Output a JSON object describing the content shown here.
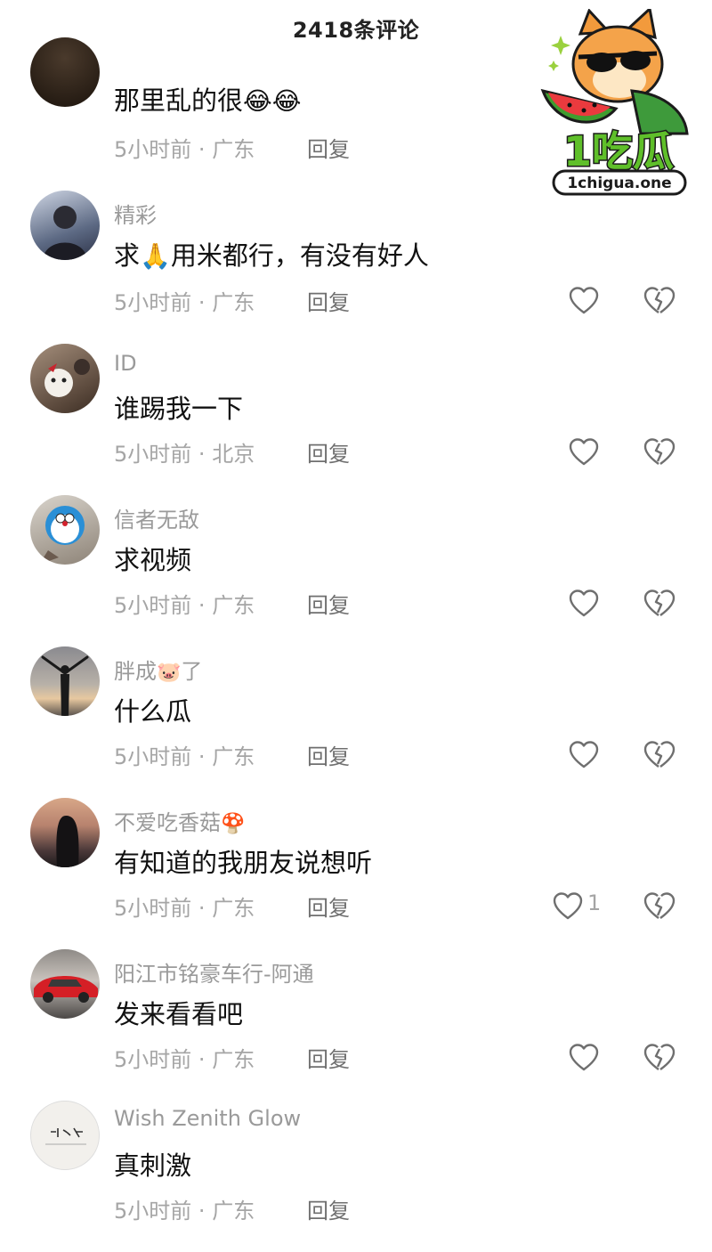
{
  "header": {
    "title": "2418条评论"
  },
  "colors": {
    "text": "#111111",
    "muted": "#a5a5a5",
    "username": "#9a9a9a",
    "icon": "#6f6f6f"
  },
  "comments": [
    {
      "username": "",
      "text": "那里乱的很",
      "emoji": "😂😂",
      "time": "5小时前",
      "sep": "·",
      "location": "广东",
      "reply": "回复",
      "likes": ""
    },
    {
      "username": "精彩",
      "text_a": "求",
      "emoji": "🙏",
      "text_b": "用米都行，有没有好人",
      "time": "5小时前",
      "sep": "·",
      "location": "广东",
      "reply": "回复",
      "likes": ""
    },
    {
      "username": "ID",
      "text": "谁踢我一下",
      "time": "5小时前",
      "sep": "·",
      "location": "北京",
      "reply": "回复",
      "likes": ""
    },
    {
      "username": "信者无敌",
      "text": "求视频",
      "time": "5小时前",
      "sep": "·",
      "location": "广东",
      "reply": "回复",
      "likes": ""
    },
    {
      "username_a": "胖成",
      "username_emoji": "🐷",
      "username_b": "了",
      "text": "什么瓜",
      "time": "5小时前",
      "sep": "·",
      "location": "广东",
      "reply": "回复",
      "likes": ""
    },
    {
      "username_a": "不爱吃香菇",
      "username_emoji": "🍄",
      "text": "有知道的我朋友说想听",
      "time": "5小时前",
      "sep": "·",
      "location": "广东",
      "reply": "回复",
      "likes": "1"
    },
    {
      "username": "阳江市铭豪车行-阿通",
      "text": "发来看看吧",
      "time": "5小时前",
      "sep": "·",
      "location": "广东",
      "reply": "回复",
      "likes": ""
    },
    {
      "username": "Wish Zenith Glow",
      "text": "真刺激",
      "time": "5小时前",
      "sep": "·",
      "location": "广东",
      "reply": "回复",
      "likes": ""
    }
  ],
  "watermark": {
    "brand": "1吃瓜",
    "domain": "1chigua.one"
  }
}
